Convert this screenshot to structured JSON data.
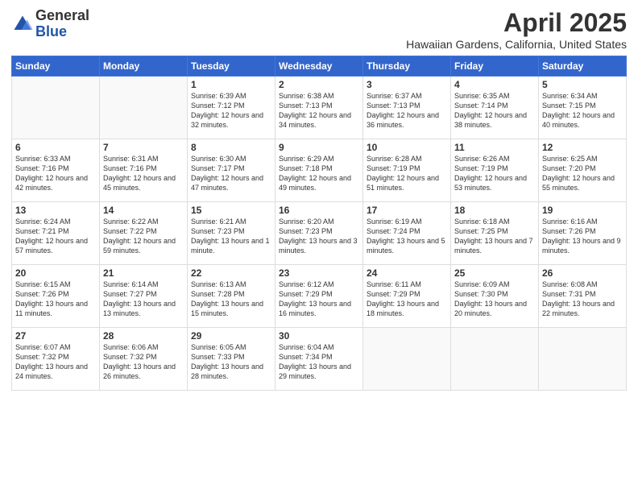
{
  "logo": {
    "general": "General",
    "blue": "Blue"
  },
  "header": {
    "title": "April 2025",
    "subtitle": "Hawaiian Gardens, California, United States"
  },
  "weekdays": [
    "Sunday",
    "Monday",
    "Tuesday",
    "Wednesday",
    "Thursday",
    "Friday",
    "Saturday"
  ],
  "weeks": [
    [
      {
        "day": "",
        "info": ""
      },
      {
        "day": "",
        "info": ""
      },
      {
        "day": "1",
        "info": "Sunrise: 6:39 AM\nSunset: 7:12 PM\nDaylight: 12 hours\nand 32 minutes."
      },
      {
        "day": "2",
        "info": "Sunrise: 6:38 AM\nSunset: 7:13 PM\nDaylight: 12 hours\nand 34 minutes."
      },
      {
        "day": "3",
        "info": "Sunrise: 6:37 AM\nSunset: 7:13 PM\nDaylight: 12 hours\nand 36 minutes."
      },
      {
        "day": "4",
        "info": "Sunrise: 6:35 AM\nSunset: 7:14 PM\nDaylight: 12 hours\nand 38 minutes."
      },
      {
        "day": "5",
        "info": "Sunrise: 6:34 AM\nSunset: 7:15 PM\nDaylight: 12 hours\nand 40 minutes."
      }
    ],
    [
      {
        "day": "6",
        "info": "Sunrise: 6:33 AM\nSunset: 7:16 PM\nDaylight: 12 hours\nand 42 minutes."
      },
      {
        "day": "7",
        "info": "Sunrise: 6:31 AM\nSunset: 7:16 PM\nDaylight: 12 hours\nand 45 minutes."
      },
      {
        "day": "8",
        "info": "Sunrise: 6:30 AM\nSunset: 7:17 PM\nDaylight: 12 hours\nand 47 minutes."
      },
      {
        "day": "9",
        "info": "Sunrise: 6:29 AM\nSunset: 7:18 PM\nDaylight: 12 hours\nand 49 minutes."
      },
      {
        "day": "10",
        "info": "Sunrise: 6:28 AM\nSunset: 7:19 PM\nDaylight: 12 hours\nand 51 minutes."
      },
      {
        "day": "11",
        "info": "Sunrise: 6:26 AM\nSunset: 7:19 PM\nDaylight: 12 hours\nand 53 minutes."
      },
      {
        "day": "12",
        "info": "Sunrise: 6:25 AM\nSunset: 7:20 PM\nDaylight: 12 hours\nand 55 minutes."
      }
    ],
    [
      {
        "day": "13",
        "info": "Sunrise: 6:24 AM\nSunset: 7:21 PM\nDaylight: 12 hours\nand 57 minutes."
      },
      {
        "day": "14",
        "info": "Sunrise: 6:22 AM\nSunset: 7:22 PM\nDaylight: 12 hours\nand 59 minutes."
      },
      {
        "day": "15",
        "info": "Sunrise: 6:21 AM\nSunset: 7:23 PM\nDaylight: 13 hours\nand 1 minute."
      },
      {
        "day": "16",
        "info": "Sunrise: 6:20 AM\nSunset: 7:23 PM\nDaylight: 13 hours\nand 3 minutes."
      },
      {
        "day": "17",
        "info": "Sunrise: 6:19 AM\nSunset: 7:24 PM\nDaylight: 13 hours\nand 5 minutes."
      },
      {
        "day": "18",
        "info": "Sunrise: 6:18 AM\nSunset: 7:25 PM\nDaylight: 13 hours\nand 7 minutes."
      },
      {
        "day": "19",
        "info": "Sunrise: 6:16 AM\nSunset: 7:26 PM\nDaylight: 13 hours\nand 9 minutes."
      }
    ],
    [
      {
        "day": "20",
        "info": "Sunrise: 6:15 AM\nSunset: 7:26 PM\nDaylight: 13 hours\nand 11 minutes."
      },
      {
        "day": "21",
        "info": "Sunrise: 6:14 AM\nSunset: 7:27 PM\nDaylight: 13 hours\nand 13 minutes."
      },
      {
        "day": "22",
        "info": "Sunrise: 6:13 AM\nSunset: 7:28 PM\nDaylight: 13 hours\nand 15 minutes."
      },
      {
        "day": "23",
        "info": "Sunrise: 6:12 AM\nSunset: 7:29 PM\nDaylight: 13 hours\nand 16 minutes."
      },
      {
        "day": "24",
        "info": "Sunrise: 6:11 AM\nSunset: 7:29 PM\nDaylight: 13 hours\nand 18 minutes."
      },
      {
        "day": "25",
        "info": "Sunrise: 6:09 AM\nSunset: 7:30 PM\nDaylight: 13 hours\nand 20 minutes."
      },
      {
        "day": "26",
        "info": "Sunrise: 6:08 AM\nSunset: 7:31 PM\nDaylight: 13 hours\nand 22 minutes."
      }
    ],
    [
      {
        "day": "27",
        "info": "Sunrise: 6:07 AM\nSunset: 7:32 PM\nDaylight: 13 hours\nand 24 minutes."
      },
      {
        "day": "28",
        "info": "Sunrise: 6:06 AM\nSunset: 7:32 PM\nDaylight: 13 hours\nand 26 minutes."
      },
      {
        "day": "29",
        "info": "Sunrise: 6:05 AM\nSunset: 7:33 PM\nDaylight: 13 hours\nand 28 minutes."
      },
      {
        "day": "30",
        "info": "Sunrise: 6:04 AM\nSunset: 7:34 PM\nDaylight: 13 hours\nand 29 minutes."
      },
      {
        "day": "",
        "info": ""
      },
      {
        "day": "",
        "info": ""
      },
      {
        "day": "",
        "info": ""
      }
    ]
  ]
}
